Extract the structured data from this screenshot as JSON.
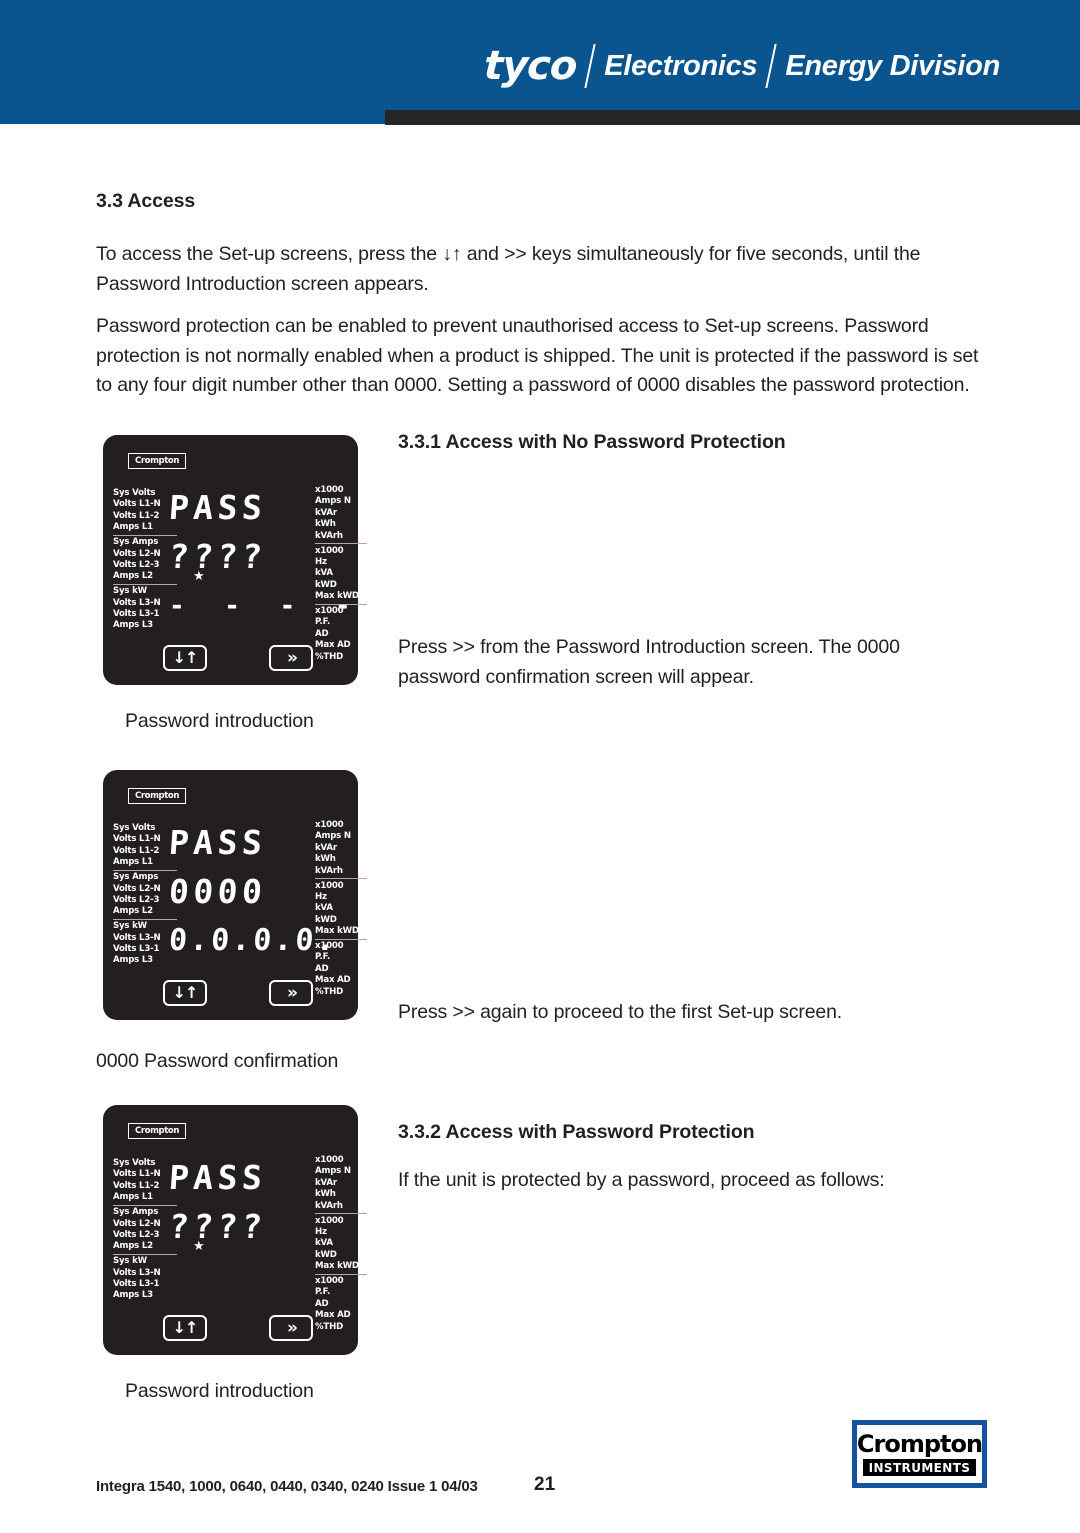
{
  "header": {
    "brand_tyco": "tyco",
    "brand_electronics": "Electronics",
    "brand_division": "Energy Division",
    "bar_color": "#0a558f",
    "rule_color": "#262626"
  },
  "body": {
    "section_33_heading": "3.3 Access",
    "paragraph_1": "To access the Set-up screens, press the ↓↑ and >> keys simultaneously for five seconds, until the Password Introduction screen appears.",
    "paragraph_2": "Password protection can be enabled to prevent unauthorised access to Set-up screens. Password protection is not normally enabled when a product is shipped. The unit is protected if the password is set to any four digit number other than 0000. Setting a password of 0000 disables the password protection.",
    "section_331_heading": "3.3.1 Access with No Password Protection",
    "paragraph_331": "Press >> from the Password Introduction screen. The 0000 password confirmation screen will appear.",
    "paragraph_332a": "Press >> again to proceed to the first Set-up screen.",
    "section_332_heading": "3.3.2 Access with Password Protection",
    "paragraph_332b": "If the unit is protected by a password, proceed as follows:",
    "caption_1": "Password introduction",
    "caption_2": "0000 Password confirmation",
    "caption_3": "Password introduction"
  },
  "meter": {
    "brand": "Crompton",
    "left_labels": [
      [
        "Sys Volts",
        "Volts L1-N",
        "Volts L1-2",
        "Amps L1"
      ],
      [
        "Sys Amps",
        "Volts L2-N",
        "Volts L2-3",
        "Amps L2"
      ],
      [
        "Sys kW",
        "Volts L3-N",
        "Volts L3-1",
        "Amps L3"
      ]
    ],
    "right_labels": [
      [
        "x1000",
        "Amps N",
        "kVAr",
        "kWh",
        "kVArh"
      ],
      [
        "x1000",
        "Hz",
        "kVA",
        "kWD",
        "Max kWD"
      ],
      [
        "x1000",
        "P.F.",
        "AD",
        "Max AD",
        "%THD"
      ]
    ],
    "button_updown": "↓↑",
    "button_next": "»",
    "screens": {
      "meter1": {
        "line1": "PASS",
        "line2": "????",
        "line3": "- - - -",
        "star": "★"
      },
      "meter2": {
        "line1": "PASS",
        "line2": "0000",
        "line3": "0.0.0.0.",
        "star": ""
      },
      "meter3": {
        "line1": "PASS",
        "line2": "????",
        "line3": "",
        "star": "★"
      }
    }
  },
  "footer": {
    "models": "Integra 1540, 1000, 0640, 0440, 0340, 0240  Issue 1 04/03",
    "page_number": "21",
    "logo_name": "Crompton",
    "logo_sub": "INSTRUMENTS",
    "logo_border_color": "#15539e"
  }
}
